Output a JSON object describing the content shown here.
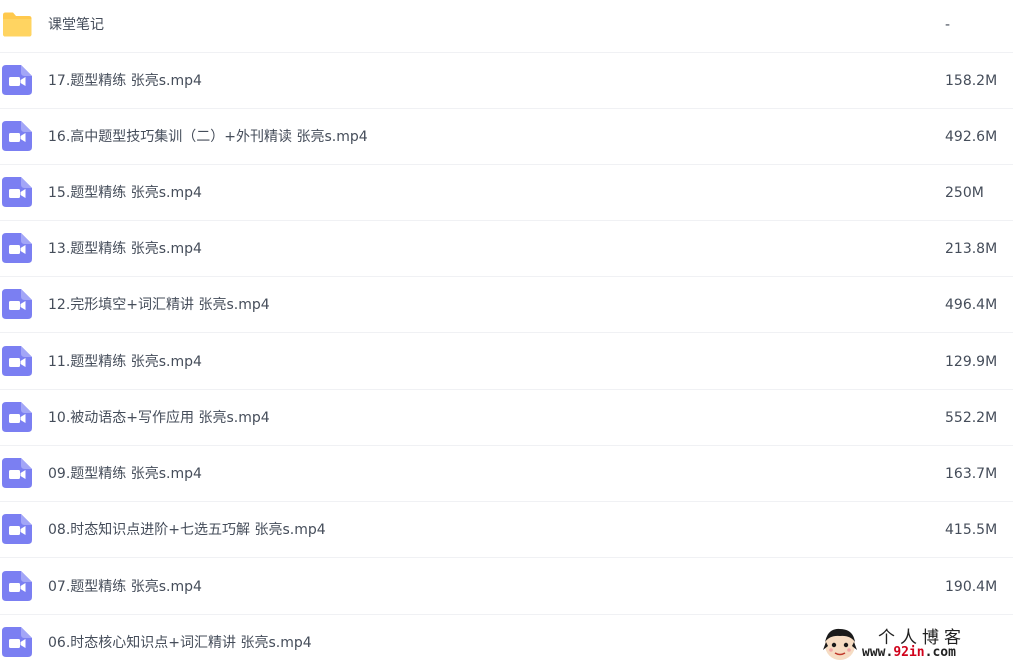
{
  "colors": {
    "folder": "#ffc94d",
    "video": "#7b7ff2",
    "text": "#454d5a",
    "divider": "#f0f1f4",
    "watermark_accent": "#d0021b"
  },
  "files": [
    {
      "icon": "folder-icon",
      "name": "课堂笔记",
      "size": "-"
    },
    {
      "icon": "video-file-icon",
      "name": "17.题型精练 张亮s.mp4",
      "size": "158.2M"
    },
    {
      "icon": "video-file-icon",
      "name": "16.高中题型技巧集训（二）+外刊精读 张亮s.mp4",
      "size": "492.6M"
    },
    {
      "icon": "video-file-icon",
      "name": "15.题型精练 张亮s.mp4",
      "size": "250M"
    },
    {
      "icon": "video-file-icon",
      "name": "13.题型精练 张亮s.mp4",
      "size": "213.8M"
    },
    {
      "icon": "video-file-icon",
      "name": "12.完形填空+词汇精讲 张亮s.mp4",
      "size": "496.4M"
    },
    {
      "icon": "video-file-icon",
      "name": "11.题型精练 张亮s.mp4",
      "size": "129.9M"
    },
    {
      "icon": "video-file-icon",
      "name": "10.被动语态+写作应用 张亮s.mp4",
      "size": "552.2M"
    },
    {
      "icon": "video-file-icon",
      "name": "09.题型精练 张亮s.mp4",
      "size": "163.7M"
    },
    {
      "icon": "video-file-icon",
      "name": "08.时态知识点进阶+七选五巧解 张亮s.mp4",
      "size": "415.5M"
    },
    {
      "icon": "video-file-icon",
      "name": "07.题型精练 张亮s.mp4",
      "size": "190.4M"
    },
    {
      "icon": "video-file-icon",
      "name": "06.时态核心知识点+词汇精讲 张亮s.mp4",
      "size": ""
    }
  ],
  "watermark": {
    "title": "个人博客",
    "url_prefix": "www.",
    "url_accent": "92in",
    "url_suffix": ".com"
  }
}
